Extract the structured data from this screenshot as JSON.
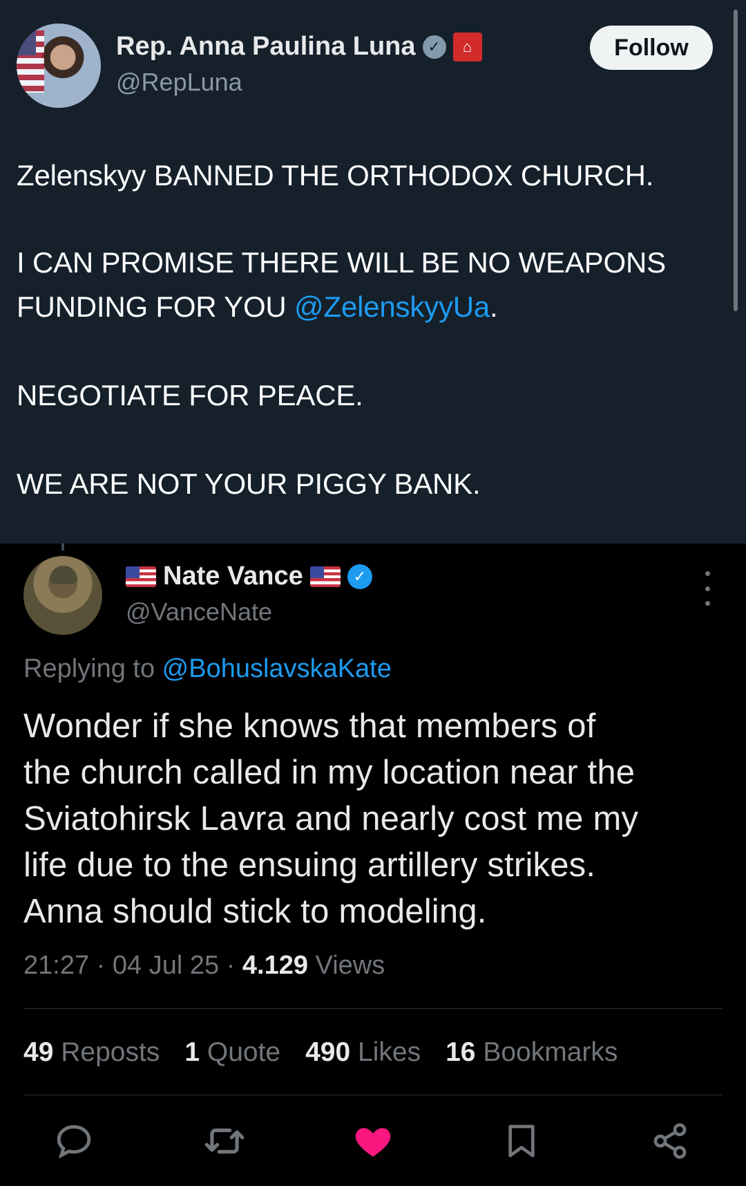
{
  "quoted_tweet": {
    "author_name": "Rep. Anna Paulina Luna",
    "author_handle": "@RepLuna",
    "follow_label": "Follow",
    "lines": [
      {
        "text": "Zelenskyy BANNED THE ORTHODOX CHURCH."
      },
      {
        "text": "I CAN PROMISE THERE WILL BE NO WEAPONS"
      },
      {
        "text": "FUNDING FOR YOU ",
        "mention": "@ZelenskyyUa",
        "after": "."
      },
      {
        "text": "NEGOTIATE FOR PEACE."
      },
      {
        "text": "WE ARE NOT YOUR PIGGY BANK."
      }
    ]
  },
  "reply_tweet": {
    "author_name": "Nate Vance",
    "author_handle": "@VanceNate",
    "replying_prefix": "Replying to ",
    "replying_to": "@BohuslavskaKate",
    "lines": [
      "Wonder if she knows that members of",
      "the church called in my location near the",
      "Sviatohirsk Lavra and nearly cost me my",
      "life due to the ensuing artillery strikes.",
      "Anna should stick to modeling."
    ],
    "time": "21:27",
    "date": "04 Jul 25",
    "views_count": "4.129",
    "views_label": "Views",
    "separator": "·"
  },
  "stats": {
    "reposts_count": "49",
    "reposts_label": "Reposts",
    "quotes_count": "1",
    "quotes_label": "Quote",
    "likes_count": "490",
    "likes_label": "Likes",
    "bookmarks_count": "16",
    "bookmarks_label": "Bookmarks"
  },
  "icons": {
    "reply": "reply-icon",
    "repost": "repost-icon",
    "like": "heart-icon",
    "bookmark": "bookmark-icon",
    "share": "share-icon"
  },
  "colors": {
    "top_card_bg": "#15202b",
    "page_bg": "#000000",
    "link": "#1d9bf0",
    "like_active": "#f91880"
  }
}
